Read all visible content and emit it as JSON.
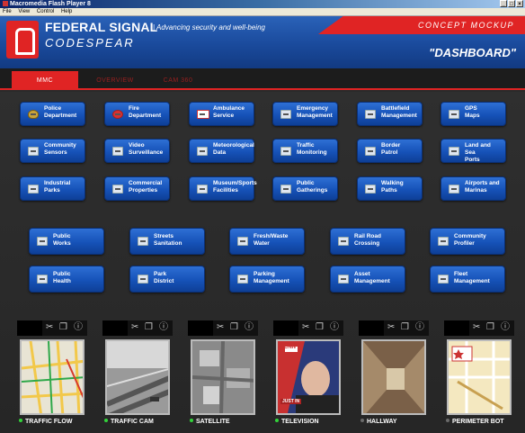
{
  "window": {
    "title": "Macromedia Flash Player 8",
    "menu": [
      "File",
      "View",
      "Control",
      "Help"
    ],
    "controls": [
      "_",
      "□",
      "×"
    ]
  },
  "header": {
    "brand": "FEDERAL SIGNAL",
    "tagline": "| Advancing security and well-being",
    "product": "CODESPEAR",
    "concept": "CONCEPT MOCKUP",
    "dashboard": "\"DASHBOARD\""
  },
  "nav": {
    "tabs": [
      "MMC",
      "OVERVIEW",
      "CAM 360"
    ]
  },
  "grid": [
    {
      "label": "Police\nDepartment",
      "icon": "police-badge-icon"
    },
    {
      "label": "Fire\nDepartment",
      "icon": "fire-icon"
    },
    {
      "label": "Ambulance\nService",
      "icon": "ambulance-icon"
    },
    {
      "label": "Emergency\nManagement",
      "icon": "emergency-icon"
    },
    {
      "label": "Battlefield\nManagement",
      "icon": "battlefield-icon"
    },
    {
      "label": "GPS\nMaps",
      "icon": "gps-icon"
    },
    {
      "label": "Community\nSensors",
      "icon": "sensor-icon"
    },
    {
      "label": "Video\nSurveillance",
      "icon": "video-icon"
    },
    {
      "label": "Meteorological\nData",
      "icon": "weather-icon"
    },
    {
      "label": "Traffic\nMonitoring",
      "icon": "traffic-icon"
    },
    {
      "label": "Border\nPatrol",
      "icon": "border-icon"
    },
    {
      "label": "Land and Sea\nPorts",
      "icon": "port-icon"
    },
    {
      "label": "Industrial\nParks",
      "icon": "industrial-icon"
    },
    {
      "label": "Commercial\nProperties",
      "icon": "commercial-icon"
    },
    {
      "label": "Museum/Sports\nFacilities",
      "icon": "museum-icon"
    },
    {
      "label": "Public\nGatherings",
      "icon": "gathering-icon"
    },
    {
      "label": "Walking\nPaths",
      "icon": "walking-icon"
    },
    {
      "label": "Airports and\nMarinas",
      "icon": "airport-icon"
    }
  ],
  "grid2": [
    {
      "label": "Public\nWorks",
      "icon": "works-icon"
    },
    {
      "label": "Streets\nSanitation",
      "icon": "sanitation-icon"
    },
    {
      "label": "Fresh/Waste\nWater",
      "icon": "water-icon"
    },
    {
      "label": "Rail Road\nCrossing",
      "icon": "rail-icon"
    },
    {
      "label": "Community\nProfiler",
      "icon": "profiler-icon"
    },
    {
      "label": "Public\nHealth",
      "icon": "health-icon"
    },
    {
      "label": "Park\nDistrict",
      "icon": "park-icon"
    },
    {
      "label": "Parking\nManagement",
      "icon": "parking-icon"
    },
    {
      "label": "Asset\nManagement",
      "icon": "asset-icon"
    },
    {
      "label": "Fleet\nManagement",
      "icon": "fleet-icon"
    }
  ],
  "cameras": [
    {
      "caption": "TRAFFIC FLOW",
      "live": true
    },
    {
      "caption": "TRAFFIC CAM",
      "live": true
    },
    {
      "caption": "SATELLITE",
      "live": true
    },
    {
      "caption": "TELEVISION",
      "live": true
    },
    {
      "caption": "HALLWAY",
      "live": false
    },
    {
      "caption": "PERIMETER BOT",
      "live": false
    }
  ],
  "tv": {
    "logo": "CNN",
    "lower_third": "JUST IN"
  }
}
